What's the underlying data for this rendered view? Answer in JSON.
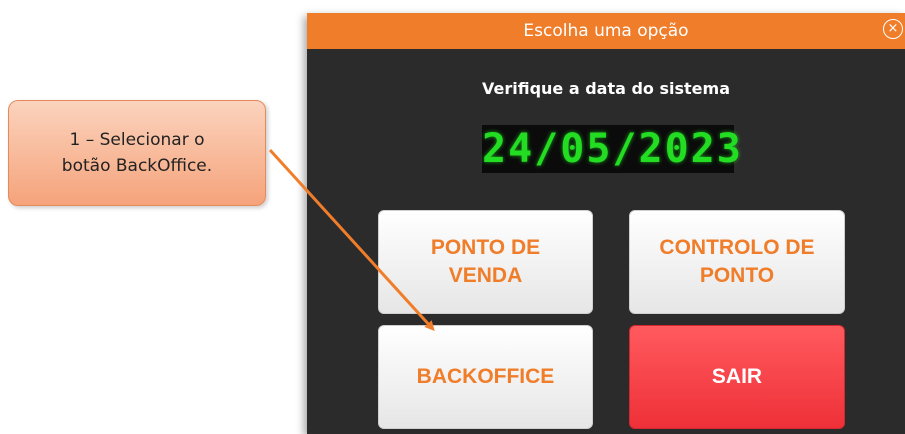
{
  "dialog": {
    "title": "Escolha uma opção",
    "close_glyph": "×",
    "subtitle": "Verifique a data do sistema",
    "date": "24/05/2023",
    "buttons": {
      "ponto_de_venda": "PONTO DE\nVENDA",
      "controlo_de_ponto": "CONTROLO DE\nPONTO",
      "backoffice": "BACKOFFICE",
      "sair": "SAIR"
    }
  },
  "annotation": {
    "callout_text": "1 – Selecionar o\nbotão BackOffice."
  },
  "colors": {
    "title_bar": "#f07d2a",
    "dialog_bg": "#2b2b2b",
    "button_text_orange": "#f07d2a",
    "exit_button": "#ef3038",
    "date_digits": "#22dd22",
    "callout_fill": "#f5a37b",
    "arrow": "#f07d2a"
  },
  "icons": {
    "close": "close-icon",
    "arrow": "arrow-icon"
  }
}
